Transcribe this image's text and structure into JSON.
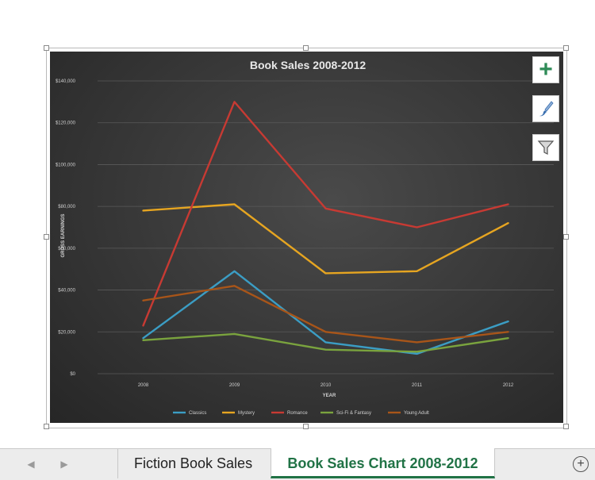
{
  "chart_data": {
    "type": "line",
    "title": "Book Sales 2008-2012",
    "xlabel": "YEAR",
    "ylabel": "GROSS EARNINGS",
    "categories": [
      "2008",
      "2009",
      "2010",
      "2011",
      "2012"
    ],
    "y_ticks": [
      "$0",
      "$20,000",
      "$40,000",
      "$60,000",
      "$80,000",
      "$100,000",
      "$120,000",
      "$140,000"
    ],
    "ylim": [
      0,
      140000
    ],
    "grid": true,
    "legend": "bottom",
    "series": [
      {
        "name": "Classics",
        "color": "#3b9dc4",
        "values": [
          17000,
          49000,
          15000,
          9500,
          25000
        ]
      },
      {
        "name": "Mystery",
        "color": "#e6a521",
        "values": [
          78000,
          81000,
          48000,
          49000,
          72000
        ]
      },
      {
        "name": "Romance",
        "color": "#c73a33",
        "values": [
          23000,
          130000,
          79000,
          70000,
          81000
        ]
      },
      {
        "name": "Sci-Fi & Fantasy",
        "color": "#7aa33e",
        "values": [
          16000,
          19000,
          11500,
          10500,
          17000
        ]
      },
      {
        "name": "Young Adult",
        "color": "#a85519",
        "values": [
          35000,
          42000,
          20000,
          15000,
          20000
        ]
      }
    ]
  },
  "side_buttons": {
    "plus_icon": "plus-icon",
    "brush_icon": "paintbrush-icon",
    "filter_icon": "filter-icon"
  },
  "tabs": {
    "items": [
      "Fiction Book Sales",
      "Book Sales Chart 2008-2012"
    ],
    "active_index": 1,
    "nav_prev": "◀",
    "nav_next": "▶",
    "add_sheet": "+"
  }
}
